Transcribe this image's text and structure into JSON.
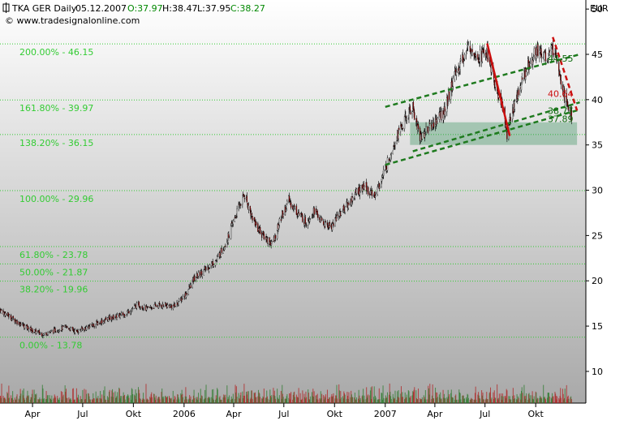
{
  "header": {
    "symbol": "TKA GER Daily",
    "date": "05.12.2007",
    "open": "O:37.97",
    "high": "H:38.47",
    "low": "L:37.95",
    "close": "C:38.27",
    "source": "© www.tradesignalonline.com",
    "currency": "EUR"
  },
  "chart_data": {
    "type": "candlestick",
    "title": "TKA GER Daily",
    "ylabel": "EUR",
    "ylim": [
      6.5,
      51
    ],
    "y_ticks": [
      10,
      15,
      20,
      25,
      30,
      35,
      40,
      45,
      50
    ],
    "x_ticks": [
      "Apr",
      "Jul",
      "Okt",
      "2006",
      "Apr",
      "Jul",
      "Okt",
      "2007",
      "Apr",
      "Jul",
      "Okt"
    ],
    "x_tick_dates": [
      "2005-04-01",
      "2005-07-01",
      "2005-10-01",
      "2006-01-01",
      "2006-04-01",
      "2006-07-01",
      "2006-10-01",
      "2007-01-01",
      "2007-04-01",
      "2007-07-01",
      "2007-10-01"
    ],
    "x_range": [
      "2005-02-01",
      "2007-12-31"
    ],
    "grid": false,
    "price_path": [
      [
        "2005-02-01",
        16.8
      ],
      [
        "2005-03-01",
        15.6
      ],
      [
        "2005-04-01",
        14.5
      ],
      [
        "2005-04-20",
        14.1
      ],
      [
        "2005-05-15",
        14.6
      ],
      [
        "2005-06-01",
        14.9
      ],
      [
        "2005-06-20",
        14.4
      ],
      [
        "2005-07-15",
        15.0
      ],
      [
        "2005-08-15",
        15.8
      ],
      [
        "2005-09-15",
        16.3
      ],
      [
        "2005-10-10",
        17.4
      ],
      [
        "2005-10-25",
        16.9
      ],
      [
        "2005-11-15",
        17.3
      ],
      [
        "2005-12-15",
        17.2
      ],
      [
        "2006-01-05",
        18.6
      ],
      [
        "2006-01-20",
        20.3
      ],
      [
        "2006-02-10",
        21.3
      ],
      [
        "2006-03-01",
        22.3
      ],
      [
        "2006-03-20",
        24.5
      ],
      [
        "2006-04-05",
        27.3
      ],
      [
        "2006-04-20",
        29.6
      ],
      [
        "2006-05-05",
        27.0
      ],
      [
        "2006-05-20",
        25.3
      ],
      [
        "2006-06-10",
        24.0
      ],
      [
        "2006-06-25",
        26.8
      ],
      [
        "2006-07-10",
        28.9
      ],
      [
        "2006-07-25",
        27.6
      ],
      [
        "2006-08-10",
        26.5
      ],
      [
        "2006-08-25",
        27.8
      ],
      [
        "2006-09-10",
        26.3
      ],
      [
        "2006-09-25",
        26.0
      ],
      [
        "2006-10-10",
        27.5
      ],
      [
        "2006-10-25",
        28.4
      ],
      [
        "2006-11-10",
        29.8
      ],
      [
        "2006-11-25",
        30.5
      ],
      [
        "2006-12-10",
        29.3
      ],
      [
        "2006-12-20",
        30.4
      ],
      [
        "2007-01-05",
        33.0
      ],
      [
        "2007-01-20",
        35.8
      ],
      [
        "2007-02-05",
        37.6
      ],
      [
        "2007-02-20",
        39.2
      ],
      [
        "2007-03-05",
        35.8
      ],
      [
        "2007-03-20",
        36.8
      ],
      [
        "2007-04-05",
        37.8
      ],
      [
        "2007-04-20",
        38.8
      ],
      [
        "2007-05-05",
        42.3
      ],
      [
        "2007-05-20",
        44.4
      ],
      [
        "2007-06-05",
        46.0
      ],
      [
        "2007-06-20",
        44.8
      ],
      [
        "2007-07-05",
        45.2
      ],
      [
        "2007-07-20",
        41.5
      ],
      [
        "2007-08-01",
        39.5
      ],
      [
        "2007-08-10",
        36.2
      ],
      [
        "2007-08-20",
        39.0
      ],
      [
        "2007-09-05",
        41.8
      ],
      [
        "2007-09-20",
        44.3
      ],
      [
        "2007-10-05",
        45.6
      ],
      [
        "2007-10-20",
        44.7
      ],
      [
        "2007-11-05",
        45.8
      ],
      [
        "2007-11-15",
        42.6
      ],
      [
        "2007-11-25",
        39.6
      ],
      [
        "2007-12-05",
        38.27
      ]
    ],
    "fibonacci_levels": [
      {
        "label": "200.00% - 46.15",
        "value": 46.15
      },
      {
        "label": "161.80% - 39.97",
        "value": 39.97
      },
      {
        "label": "138.20% - 36.15",
        "value": 36.15
      },
      {
        "label": "100.00% - 29.96",
        "value": 29.96
      },
      {
        "label": "61.80% - 23.78",
        "value": 23.78
      },
      {
        "label": "50.00% - 21.87",
        "value": 21.87
      },
      {
        "label": "38.20% - 19.96",
        "value": 19.96
      },
      {
        "label": "0.00% - 13.78",
        "value": 13.78
      }
    ],
    "trend_lines": [
      {
        "kind": "channel-upper",
        "style": "dashed",
        "color": "#1e7a1e",
        "from": [
          "2007-01-01",
          39.2
        ],
        "to": [
          "2007-12-20",
          45.0
        ]
      },
      {
        "kind": "channel-lower",
        "style": "dashed",
        "color": "#1e7a1e",
        "from": [
          "2007-01-01",
          32.8
        ],
        "to": [
          "2007-12-20",
          38.9
        ]
      },
      {
        "kind": "channel-mid",
        "style": "dashed",
        "color": "#1e7a1e",
        "from": [
          "2007-02-20",
          34.3
        ],
        "to": [
          "2007-12-20",
          39.7
        ]
      },
      {
        "kind": "downtrend",
        "style": "solid",
        "color": "#cc1010",
        "from": [
          "2007-07-05",
          46.2
        ],
        "to": [
          "2007-08-15",
          36.0
        ]
      },
      {
        "kind": "downtrend",
        "style": "dashed",
        "color": "#cc1010",
        "from": [
          "2007-11-01",
          46.9
        ],
        "to": [
          "2007-12-15",
          38.8
        ]
      }
    ],
    "zone": {
      "from": "2007-02-15",
      "to": "2007-12-15",
      "low": 35.0,
      "high": 37.5
    },
    "price_labels": [
      {
        "label": "44.55",
        "value": 44.55,
        "color": "#0c6a0c"
      },
      {
        "label": "40.64",
        "value": 40.64,
        "color": "#cc1010"
      },
      {
        "label": "38.77",
        "value": 38.77,
        "color": "#0c6a0c"
      },
      {
        "label": "37.89",
        "value": 37.89,
        "color": "#0c6a0c"
      }
    ],
    "volume_baseline": 6.5
  },
  "colors": {
    "background_top": "#ffffff",
    "background_bottom": "#a9a9a9",
    "fib_line": "#33cc33",
    "fib_text": "#33cc33",
    "candle_up": "#ffffff",
    "candle_down": "#a00000",
    "volume_up": "#2a7a2a",
    "volume_down": "#b02020",
    "header_green": "#008800"
  }
}
